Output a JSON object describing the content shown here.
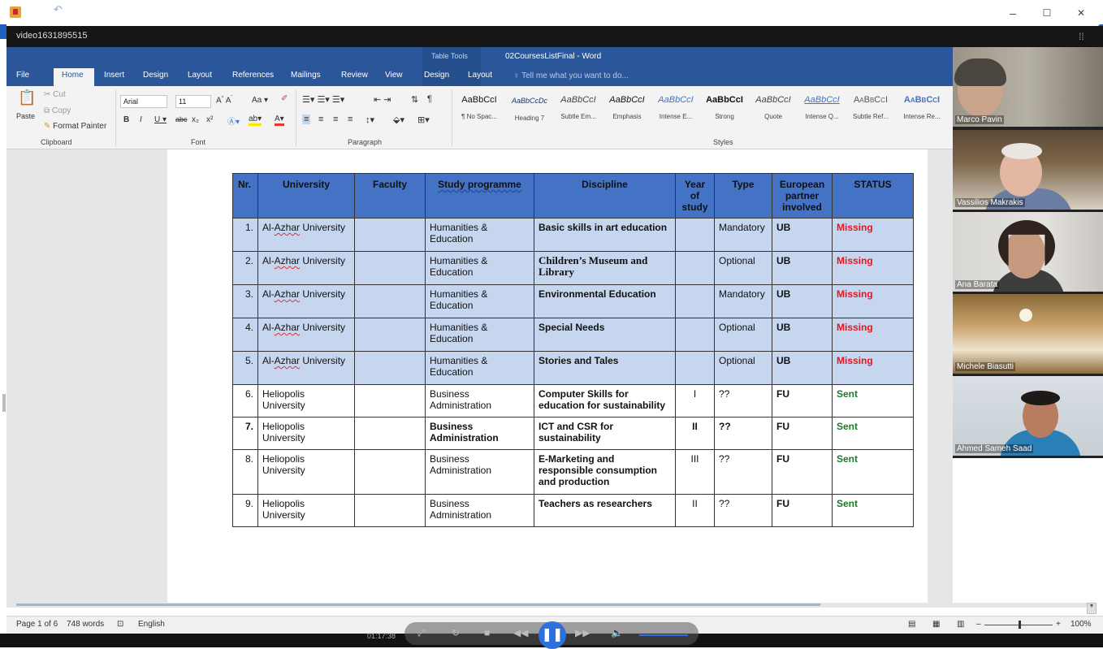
{
  "outer_window": {
    "minimize": "–",
    "maximize": "☐",
    "close": "✕"
  },
  "video": {
    "title": "video1631895515",
    "time": "01:17:38"
  },
  "word": {
    "doc_title": "02CoursesListFinal - Word",
    "table_tools": "Table Tools",
    "tabs": [
      "File",
      "Home",
      "Insert",
      "Design",
      "Layout",
      "References",
      "Mailings",
      "Review",
      "View",
      "Design",
      "Layout"
    ],
    "tell_me": "Tell me what you want to do...",
    "clipboard": {
      "cut": "Cut",
      "copy": "Copy",
      "paste": "Paste",
      "format_painter": "Format Painter",
      "label": "Clipboard"
    },
    "font": {
      "name": "Arial",
      "size": "11",
      "label": "Font"
    },
    "paragraph_label": "Paragraph",
    "styles_label": "Styles",
    "styles": [
      {
        "sample": "AaBbCcI",
        "name": "¶ No Spac..."
      },
      {
        "sample": "AaBbCcDc",
        "name": "Heading 7"
      },
      {
        "sample": "AaBbCcI",
        "name": "Subtle Em..."
      },
      {
        "sample": "AaBbCcI",
        "name": "Emphasis"
      },
      {
        "sample": "AaBbCcI",
        "name": "Intense E..."
      },
      {
        "sample": "AaBbCcI",
        "name": "Strong"
      },
      {
        "sample": "AaBbCcI",
        "name": "Quote"
      },
      {
        "sample": "AaBbCcI",
        "name": "Intense Q..."
      },
      {
        "sample": "AaBbCcI",
        "name": "Subtle Ref..."
      },
      {
        "sample": "AaBbCcI",
        "name": "Intense Re..."
      }
    ],
    "status": {
      "page": "Page 1 of 6",
      "words": "748 words",
      "language": "English",
      "zoom": "100%"
    }
  },
  "table": {
    "headers": [
      "Nr.",
      "University",
      "Faculty",
      "Study programme",
      "Discipline",
      "Year of study",
      "Type",
      "European partner involved",
      "STATUS"
    ],
    "rows": [
      {
        "nr": "1.",
        "university": "Al-Azhar University",
        "faculty": "",
        "programme": "Humanities & Education",
        "discipline": "Basic skills in art education",
        "year": "",
        "type": "Mandatory",
        "partner": "UB",
        "status": "Missing"
      },
      {
        "nr": "2.",
        "university": "Al-Azhar University",
        "faculty": "",
        "programme": "Humanities & Education",
        "discipline": "Children’s Museum and Library",
        "year": "",
        "type": "Optional",
        "partner": "UB",
        "status": "Missing"
      },
      {
        "nr": "3.",
        "university": "Al-Azhar University",
        "faculty": "",
        "programme": "Humanities & Education",
        "discipline": "Environmental Education",
        "year": "",
        "type": "Mandatory",
        "partner": "UB",
        "status": "Missing"
      },
      {
        "nr": "4.",
        "university": "Al-Azhar University",
        "faculty": "",
        "programme": "Humanities & Education",
        "discipline": "Special Needs",
        "year": "",
        "type": "Optional",
        "partner": "UB",
        "status": "Missing"
      },
      {
        "nr": "5.",
        "university": "Al-Azhar University",
        "faculty": "",
        "programme": "Humanities & Education",
        "discipline": "Stories and Tales",
        "year": "",
        "type": "Optional",
        "partner": "UB",
        "status": "Missing"
      },
      {
        "nr": "6.",
        "university": "Heliopolis University",
        "faculty": "",
        "programme": "Business Administration",
        "discipline": "Computer Skills for education for sustainability",
        "year": "I",
        "type": "??",
        "partner": "FU",
        "status": "Sent"
      },
      {
        "nr": "7.",
        "university": "Heliopolis University",
        "faculty": "",
        "programme": "Business Administration",
        "discipline": "ICT and CSR for sustainability",
        "year": "II",
        "type": "??",
        "partner": "FU",
        "status": "Sent"
      },
      {
        "nr": "8.",
        "university": "Heliopolis University",
        "faculty": "",
        "programme": "Business Administration",
        "discipline": "E-Marketing and responsible consumption and production",
        "year": "III",
        "type": "??",
        "partner": "FU",
        "status": "Sent"
      },
      {
        "nr": "9.",
        "university": "Heliopolis University",
        "faculty": "",
        "programme": "Business Administration",
        "discipline": "Teachers as researchers",
        "year": "II",
        "type": "??",
        "partner": "FU",
        "status": "Sent"
      }
    ]
  },
  "participants": [
    "Marco Pavin",
    "Vassilios Makrakis",
    "Ana Barata",
    "Michele Biasutti",
    "Ahmed Sameh Saad"
  ],
  "colors": {
    "ribbon": "#2b579a",
    "header_blue": "#4472c4",
    "row_blue": "#c5d6ee",
    "missing": "#e8141e",
    "sent": "#1b7a2a"
  }
}
